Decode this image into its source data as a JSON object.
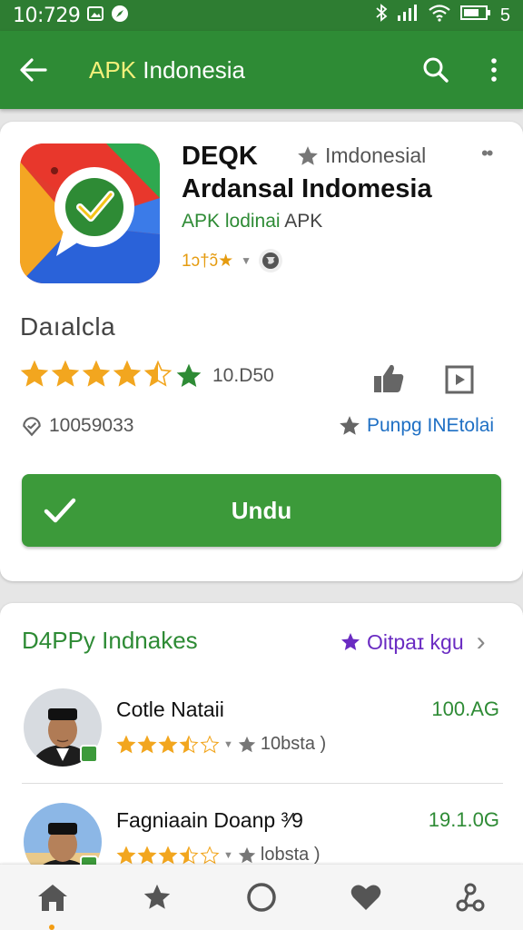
{
  "status_bar": {
    "time": "10:729",
    "right_text": "5"
  },
  "app_bar": {
    "title_highlight": "APK",
    "title_rest": " Indonesia"
  },
  "app_card": {
    "name_line1": "DEQK",
    "language": "Imdonesial",
    "name_line2": "Ardansal Indomesia",
    "sub_green": "APK lodinai",
    "sub_rest": " APK",
    "mini_rating": "1ɔ†ɔ̃★",
    "section_title": "Daıalcla",
    "rating_count": "10.D50",
    "location_count": "10059033",
    "popular_label": "Punpg INEtolai",
    "download_label": "Undu",
    "stars": [
      1,
      1,
      1,
      1,
      0.5
    ],
    "colors": {
      "accent": "#3c9a3a",
      "star": "#f2a61f",
      "link": "#1e6fc4"
    }
  },
  "list_card": {
    "title": "D4PPy Indnakes",
    "link_label": "Oitpaɪ kgu",
    "items": [
      {
        "name": "Cotle Nataii",
        "rating_label": "10bsta )",
        "value": "100.AG",
        "stars": [
          1,
          1,
          1,
          0.5,
          0
        ]
      },
      {
        "name": "Fagniaain Doanp ³⁄9",
        "rating_label": "lobsta )",
        "value": "19.1.0G",
        "stars": [
          1,
          1,
          1,
          0.5,
          0
        ]
      }
    ]
  },
  "bottom_nav": [
    "home-icon",
    "star-icon",
    "circle-icon",
    "heart-icon",
    "share-icon"
  ]
}
